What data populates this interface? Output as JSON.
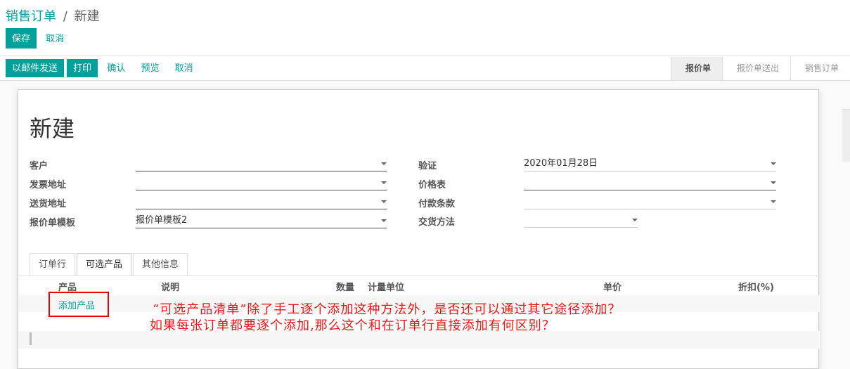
{
  "breadcrumb": {
    "parent": "销售订单",
    "separator": "/",
    "current": "新建"
  },
  "control_panel": {
    "save_label": "保存",
    "discard_label": "取消"
  },
  "statusbar": {
    "buttons": [
      "以邮件发送",
      "打印",
      "确认",
      "预览",
      "取消"
    ],
    "stages": [
      "报价单",
      "报价单送出",
      "销售订单"
    ],
    "active_stage": "报价单"
  },
  "form": {
    "title": "新建",
    "left_fields": [
      {
        "label": "客户",
        "value": ""
      },
      {
        "label": "发票地址",
        "value": ""
      },
      {
        "label": "送货地址",
        "value": ""
      },
      {
        "label": "报价单模板",
        "value": "报价单模板2"
      }
    ],
    "right_fields": [
      {
        "label": "验证",
        "value": "2020年01月28日"
      },
      {
        "label": "价格表",
        "value": ""
      },
      {
        "label": "付款条款",
        "value": ""
      },
      {
        "label": "交货方法",
        "value": ""
      }
    ]
  },
  "tabs": [
    "订单行",
    "可选产品",
    "其他信息"
  ],
  "active_tab": "可选产品",
  "table": {
    "headers": [
      "产品",
      "说明",
      "数量",
      "计量单位",
      "单价",
      "折扣(%)"
    ],
    "add_product_label": "添加产品"
  },
  "annotation": {
    "line1": "“可选产品清单”除了手工逐个添加这种方法外，是否还可以通过其它途径添加？",
    "line2": "如果每张订单都要逐个添加,那么这个和在订单行直接添加有何区别？",
    "color": "#e81818"
  },
  "colors": {
    "accent": "#00A09D"
  }
}
